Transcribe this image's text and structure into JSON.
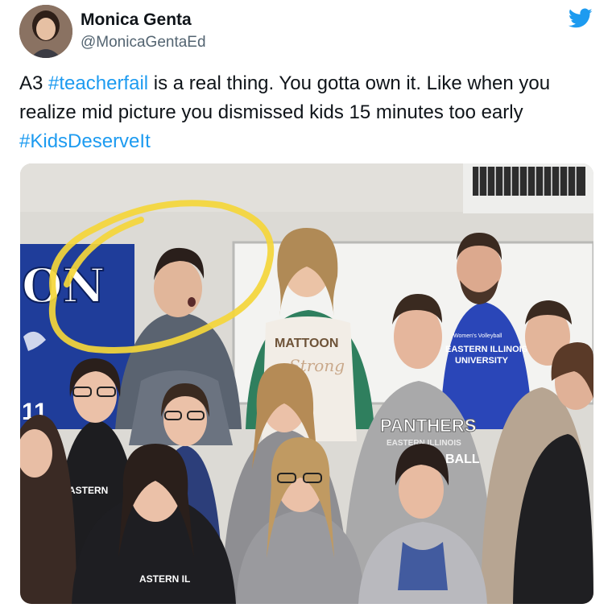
{
  "tweet": {
    "author": {
      "name": "Monica Genta",
      "handle": "@MonicaGentaEd"
    },
    "platform_icon": "twitter-bird-icon",
    "text_parts": {
      "prefix": "A3 ",
      "hashtag1": "#teacherfail",
      "middle": " is a real thing. You gotta own it. Like when you realize mid picture you dismissed kids 15 minutes too early  ",
      "hashtag2": "#KidsDeserveIt"
    },
    "photo": {
      "banner_text": "ON",
      "shirt_texts": {
        "mattoon": "MATTOON",
        "mattoon_script": "Strong",
        "eiu_small": "Women's Volleyball",
        "eiu_line1": "EASTERN ILLINOIS",
        "eiu_line2": "UNIVERSITY",
        "panthers": "PANTHERS",
        "panthers_sub": "EASTERN ILLINOIS",
        "ball": "BALL",
        "eastern_left": "ASTERN",
        "eastern_bottom": "ASTERN IL"
      }
    }
  },
  "colors": {
    "hashtag": "#1d9bf0",
    "twitter_blue": "#1d9bf0",
    "highlight_circle": "#f4d63a",
    "eiu_blue": "#1f3d9a"
  }
}
